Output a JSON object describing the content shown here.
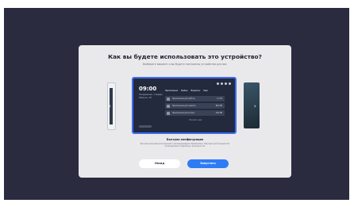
{
  "dialog": {
    "title": "Как вы будете использовать это устройство?",
    "subtitle": "Выберите вариант и вы будете настроены устройство для вас",
    "selected_mode": {
      "title": "Быстрая конфигурация",
      "description": "Быстрая настройка всех функций с рекомендуемыми параметрами. Подходит для большинства пользователей. Подробнее о возможностях"
    },
    "preview": {
      "clock": "09:00",
      "date": "Понедельник, 1 января",
      "weather": "Облачно, 18°",
      "tabs": [
        "Приложения",
        "Файлы",
        "Виджеты",
        "Ещё"
      ],
      "apps": [
        {
          "name": "Приложение для работы",
          "size": "1.2 ГБ"
        },
        {
          "name": "Приложение для заметок",
          "size": "860 МБ"
        },
        {
          "name": "Приложение для встреч",
          "size": "540 МБ"
        }
      ],
      "more": "Показать ещё"
    },
    "back_label": "Назад",
    "start_label": "Запустить"
  },
  "icons": {
    "prev": "chevron-left-icon",
    "next": "chevron-right-icon"
  },
  "colors": {
    "background": "#2a2b3f",
    "accent": "#2d7cf6",
    "selection_border": "#3d6df2"
  }
}
